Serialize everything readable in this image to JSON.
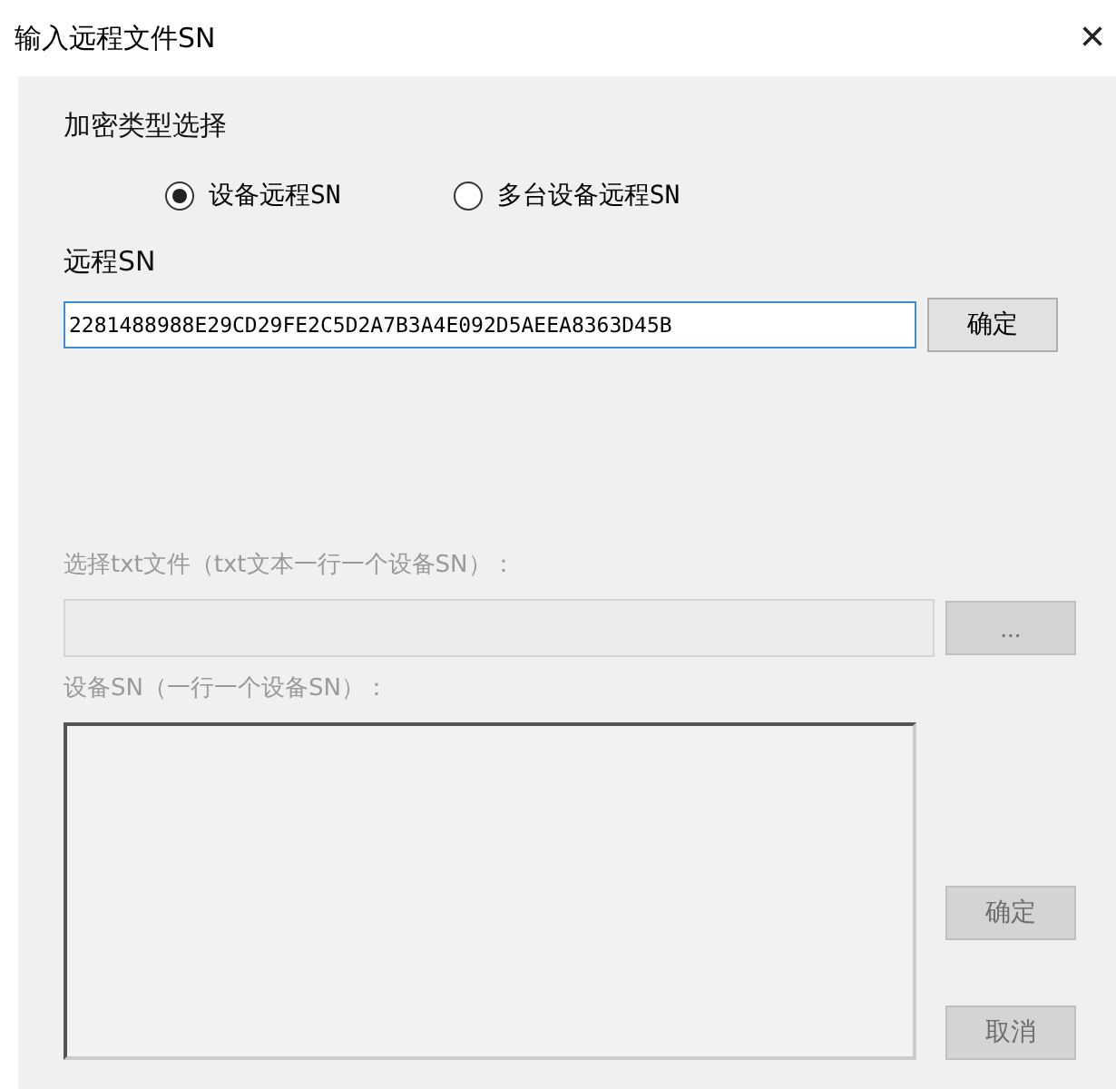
{
  "window": {
    "title": "输入远程文件SN",
    "close": "×"
  },
  "encryption_type": {
    "label": "加密类型选择",
    "options": [
      {
        "label": "设备远程SN",
        "selected": true
      },
      {
        "label": "多台设备远程SN",
        "selected": false
      }
    ]
  },
  "remote_sn": {
    "label": "远程SN",
    "value": "2281488988E29CD29FE2C5D2A7B3A4E092D5AEEA8363D45B",
    "button": "确定"
  },
  "txt_file": {
    "label": "选择txt文件（txt文本一行一个设备SN）：",
    "button": "...",
    "disabled": true
  },
  "device_sn": {
    "label": "设备SN（一行一个设备SN）：",
    "disabled": true,
    "buttons": [
      "确定",
      "取消"
    ]
  }
}
